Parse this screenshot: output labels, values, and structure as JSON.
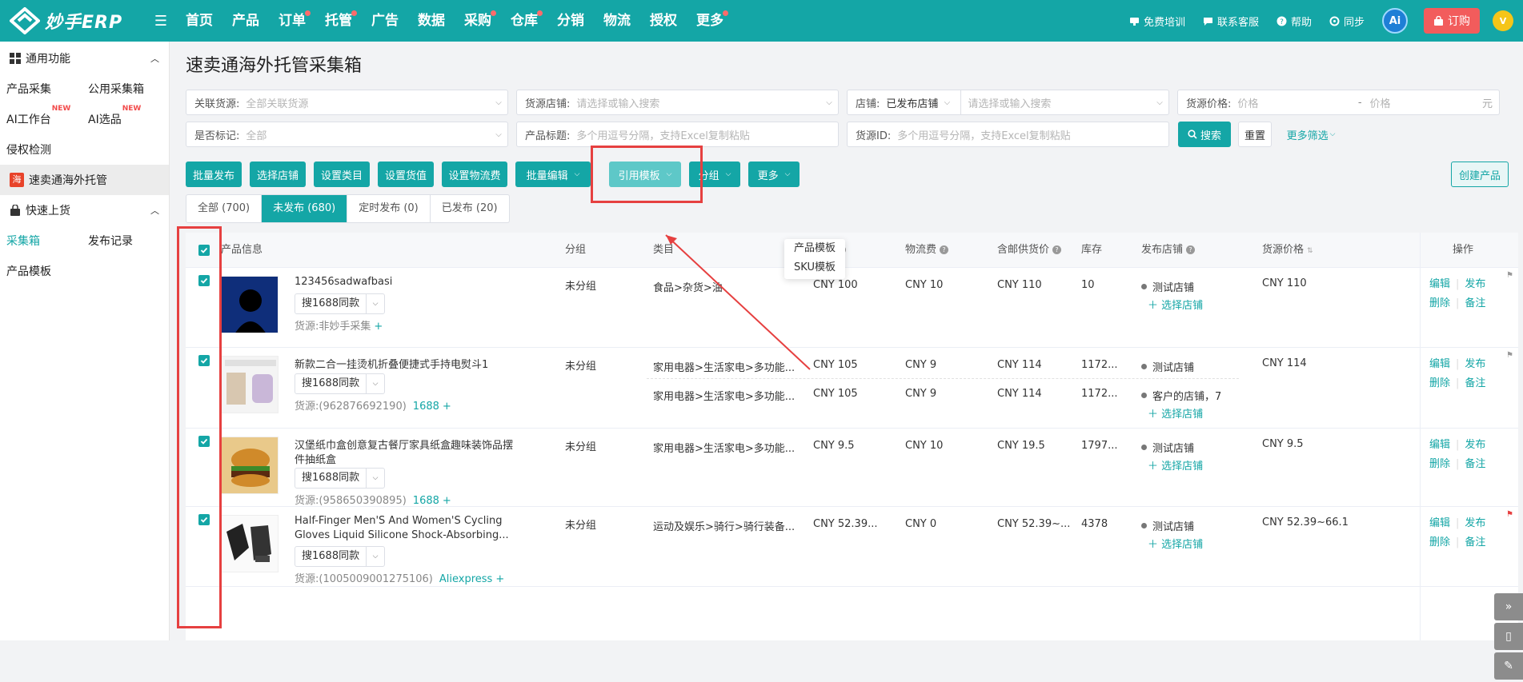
{
  "app": {
    "logo_text": "妙手ERP"
  },
  "nav": [
    {
      "label": "首页",
      "dot": false
    },
    {
      "label": "产品",
      "dot": false
    },
    {
      "label": "订单",
      "dot": true
    },
    {
      "label": "托管",
      "dot": true
    },
    {
      "label": "广告",
      "dot": false
    },
    {
      "label": "数据",
      "dot": false
    },
    {
      "label": "采购",
      "dot": true
    },
    {
      "label": "仓库",
      "dot": true
    },
    {
      "label": "分销",
      "dot": false
    },
    {
      "label": "物流",
      "dot": false
    },
    {
      "label": "授权",
      "dot": false
    },
    {
      "label": "更多",
      "dot": true
    }
  ],
  "topright": {
    "training": "免费培训",
    "service": "联系客服",
    "help": "帮助",
    "sync": "同步",
    "ai": "Ai",
    "order": "订购",
    "avatar": "V"
  },
  "sidebar": {
    "group1": "通用功能",
    "collect": "产品采集",
    "public_box": "公用采集箱",
    "ai_workbench": "AI工作台",
    "ai_select": "AI选品",
    "new_badge": "NEW",
    "infringe": "侵权检测",
    "active_item_icon": "海",
    "active_item": "速卖通海外托管",
    "group2": "快速上货",
    "collect_box": "采集箱",
    "publish_record": "发布记录",
    "product_template": "产品模板"
  },
  "page": {
    "title": "速卖通海外托管采集箱"
  },
  "filters": {
    "related_source_label": "关联货源:",
    "related_source_value": "全部关联货源",
    "source_shop_label": "货源店铺:",
    "source_shop_ph": "请选择或输入搜索",
    "shop_label": "店铺:",
    "shop_value": "已发布店铺",
    "shop_ph": "请选择或输入搜索",
    "price_label": "货源价格:",
    "price_ph1": "价格",
    "price_dash": "-",
    "price_ph2": "价格",
    "price_unit": "元",
    "marked_label": "是否标记:",
    "marked_value": "全部",
    "title_label": "产品标题:",
    "title_ph": "多个用逗号分隔，支持Excel复制粘贴",
    "srcid_label": "货源ID:",
    "srcid_ph": "多个用逗号分隔，支持Excel复制粘贴",
    "search": "搜索",
    "reset": "重置",
    "more_filter": "更多筛选"
  },
  "actions": {
    "batch_publish": "批量发布",
    "select_shop": "选择店铺",
    "set_category": "设置类目",
    "set_value": "设置货值",
    "set_logistics": "设置物流费",
    "batch_edit": "批量编辑",
    "apply_template": "引用模板",
    "group": "分组",
    "more": "更多",
    "create_product": "创建产品"
  },
  "template_menu": [
    "产品模板",
    "SKU模板"
  ],
  "tabs": [
    {
      "label": "全部 (700)",
      "active": false
    },
    {
      "label": "未发布 (680)",
      "active": true
    },
    {
      "label": "定时发布 (0)",
      "active": false
    },
    {
      "label": "已发布 (20)",
      "active": false
    }
  ],
  "columns": {
    "info": "产品信息",
    "group": "分组",
    "category": "类目",
    "value": "货值",
    "logistics": "物流费",
    "postage_price": "含邮供货价",
    "stock": "库存",
    "publish_shop": "发布店铺",
    "source_price": "货源价格",
    "ops": "操作"
  },
  "common": {
    "search_same": "搜1688同款",
    "source_prefix": "货源:",
    "select_shop": "选择店铺",
    "edit": "编辑",
    "publish": "发布",
    "delete": "删除",
    "note": "备注",
    "add": "+"
  },
  "rows": [
    {
      "title1": "123456sadwafbasi",
      "title2": "",
      "source": "非妙手采集",
      "source_tag": "",
      "group": "未分组",
      "skus": [
        {
          "category": "食品>杂货>油",
          "value": "CNY 100",
          "logistics": "CNY 10",
          "postage": "CNY 110",
          "stock": "10",
          "shop": "测试店铺"
        }
      ],
      "source_price": "CNY 110"
    },
    {
      "title1": "新款二合一挂烫机折叠便捷式手持电熨斗1",
      "title2": "",
      "source": "(962876692190)",
      "source_tag": "1688",
      "group": "未分组",
      "skus": [
        {
          "category": "家用电器>生活家电>多功能...",
          "value": "CNY 105",
          "logistics": "CNY 9",
          "postage": "CNY 114",
          "stock": "1172...",
          "shop": "测试店铺"
        },
        {
          "category": "家用电器>生活家电>多功能...",
          "value": "CNY 105",
          "logistics": "CNY 9",
          "postage": "CNY 114",
          "stock": "1172...",
          "shop": "客户的店铺，7"
        }
      ],
      "source_price": "CNY 114"
    },
    {
      "title1": "汉堡纸巾盒创意复古餐厅家具纸盒趣味装饰品摆",
      "title2": "件抽纸盒",
      "source": "(958650390895)",
      "source_tag": "1688",
      "group": "未分组",
      "skus": [
        {
          "category": "家用电器>生活家电>多功能...",
          "value": "CNY 9.5",
          "logistics": "CNY 10",
          "postage": "CNY 19.5",
          "stock": "1797...",
          "shop": "测试店铺"
        }
      ],
      "source_price": "CNY 9.5"
    },
    {
      "title1": "Half-Finger Men'S And Women'S Cycling",
      "title2": "Gloves Liquid Silicone Shock-Absorbing...",
      "source": "(1005009001275106)",
      "source_tag": "Aliexpress",
      "group": "未分组",
      "skus": [
        {
          "category": "运动及娱乐>骑行>骑行装备...",
          "value": "CNY 52.39...",
          "logistics": "CNY 0",
          "postage": "CNY 52.39~...",
          "stock": "4378",
          "shop": "测试店铺"
        }
      ],
      "source_price": "CNY 52.39~66.1"
    }
  ],
  "colors": {
    "primary": "#14a6a6",
    "highlight_box": "#e64040",
    "order_button": "#f25c5c"
  }
}
